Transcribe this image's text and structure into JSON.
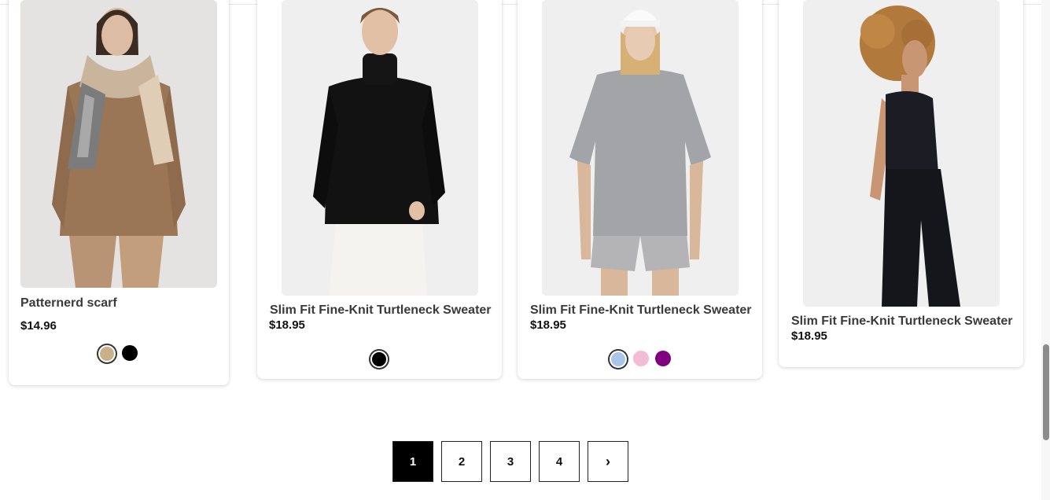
{
  "products": [
    {
      "title": "Patternerd scarf",
      "price": "$14.96",
      "image_icon": "scarf-model-photo",
      "swatches": [
        {
          "color": "#c8b08a",
          "selected": true
        },
        {
          "color": "#000000",
          "selected": false
        }
      ]
    },
    {
      "title": "Slim Fit Fine-Knit Turtleneck Sweater",
      "price": "$18.95",
      "image_icon": "black-turtleneck-photo",
      "swatches": [
        {
          "color": "#000000",
          "selected": true
        }
      ]
    },
    {
      "title": "Slim Fit Fine-Knit Turtleneck Sweater",
      "price": "$18.95",
      "image_icon": "grey-tshirt-photo",
      "swatches": [
        {
          "color": "#a9c6e6",
          "selected": true
        },
        {
          "color": "#f2bcd6",
          "selected": false
        },
        {
          "color": "#800080",
          "selected": false
        }
      ]
    },
    {
      "title": "Slim Fit Fine-Knit Turtleneck Sweater",
      "price": "$18.95",
      "image_icon": "black-tank-top-photo",
      "swatches": []
    }
  ],
  "pagination": {
    "pages": [
      "1",
      "2",
      "3",
      "4"
    ],
    "active": "1",
    "next_icon": "chevron-right-icon",
    "next_label": "›"
  }
}
